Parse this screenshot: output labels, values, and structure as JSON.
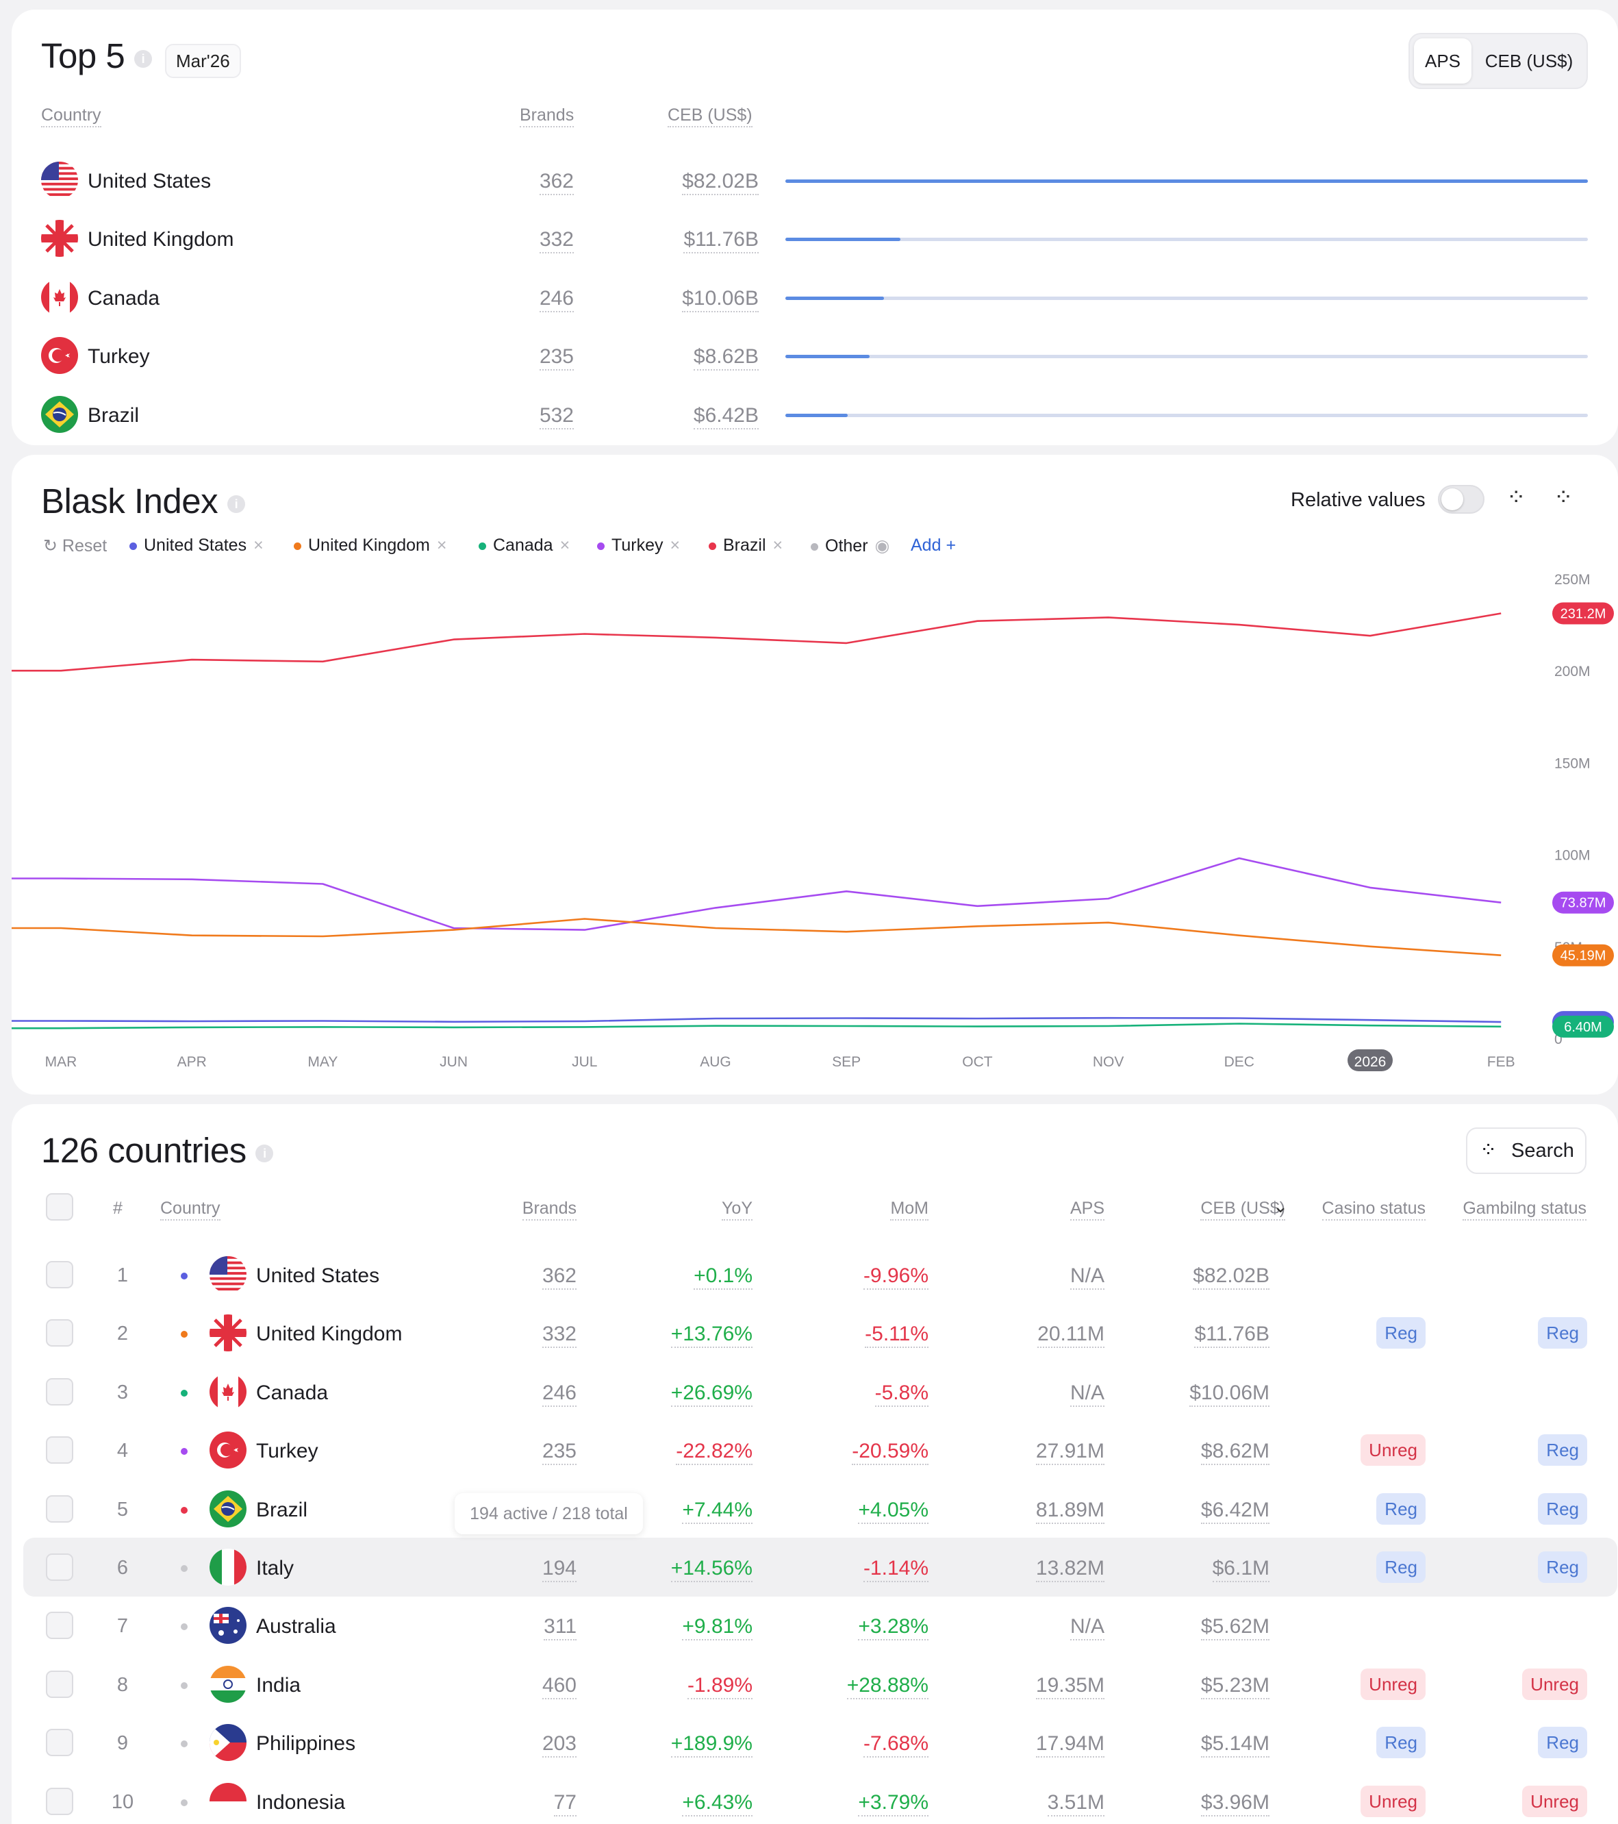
{
  "top5": {
    "title": "Top 5",
    "period": "Mar'26",
    "toggle": {
      "left": "APS",
      "right": "CEB (US$)"
    },
    "headers": {
      "country": "Country",
      "brands": "Brands",
      "ceb": "CEB (US$)"
    },
    "rows": [
      {
        "country": "United States",
        "brands": "362",
        "ceb": "$82.02B",
        "share": 1.0
      },
      {
        "country": "United Kingdom",
        "brands": "332",
        "ceb": "$11.76B",
        "share": 0.143
      },
      {
        "country": "Canada",
        "brands": "246",
        "ceb": "$10.06B",
        "share": 0.123
      },
      {
        "country": "Turkey",
        "brands": "235",
        "ceb": "$8.62B",
        "share": 0.105
      },
      {
        "country": "Brazil",
        "brands": "532",
        "ceb": "$6.42B",
        "share": 0.078
      }
    ]
  },
  "blask": {
    "title": "Blask Index",
    "relative_label": "Relative values",
    "reset_label": "Reset",
    "add_label": "Add",
    "legend": [
      {
        "name": "United States",
        "color": "#5b5fe0"
      },
      {
        "name": "United Kingdom",
        "color": "#f07a1c"
      },
      {
        "name": "Canada",
        "color": "#16b27a"
      },
      {
        "name": "Turkey",
        "color": "#a64bf0"
      },
      {
        "name": "Brazil",
        "color": "#e8354c"
      },
      {
        "name": "Other",
        "color": "#b8b8be"
      }
    ]
  },
  "chart_data": {
    "type": "line",
    "x": [
      "MAR",
      "APR",
      "MAY",
      "JUN",
      "JUL",
      "AUG",
      "SEP",
      "OCT",
      "NOV",
      "DEC",
      "2026",
      "FEB"
    ],
    "yticks": [
      "250M",
      "200M",
      "150M",
      "100M",
      "50M",
      "0"
    ],
    "ylim": [
      0,
      250
    ],
    "grid": false,
    "series": [
      {
        "name": "Brazil",
        "color": "#e8354c",
        "end_label": "231.2M",
        "values": [
          200,
          206,
          205,
          217,
          220,
          218,
          215,
          227,
          229,
          225,
          219,
          231.2
        ]
      },
      {
        "name": "Turkey",
        "color": "#a64bf0",
        "end_label": "73.87M",
        "values": [
          87,
          86.5,
          84,
          60,
          59,
          71,
          80,
          72,
          76,
          98,
          82,
          73.87
        ]
      },
      {
        "name": "United Kingdom",
        "color": "#f07a1c",
        "end_label": "45.19M",
        "values": [
          60,
          56,
          55.5,
          59,
          65,
          60,
          58,
          61,
          63,
          56,
          50,
          45.19
        ]
      },
      {
        "name": "United States",
        "color": "#5b5fe0",
        "end_label": "8.89M",
        "values": [
          9.5,
          9.3,
          9.5,
          9.0,
          9.3,
          10.8,
          11.0,
          10.8,
          11.1,
          11.0,
          10.0,
          8.89
        ]
      },
      {
        "name": "Canada",
        "color": "#16b27a",
        "end_label": "6.40M",
        "values": [
          5.5,
          6.0,
          6.2,
          6.0,
          6.2,
          6.8,
          6.7,
          6.5,
          6.7,
          8.0,
          7.0,
          6.4
        ]
      }
    ]
  },
  "countries": {
    "title": "126 countries",
    "search_label": "Search",
    "headers": {
      "num": "#",
      "country": "Country",
      "brands": "Brands",
      "yoy": "YoY",
      "mom": "MoM",
      "aps": "APS",
      "ceb": "CEB (US$)",
      "casino": "Casino status",
      "gambling": "Gambilng status"
    },
    "tooltip": "194 active / 218 total",
    "rows": [
      {
        "num": "1",
        "country": "United States",
        "dot": "#5b5fe0",
        "brands": "362",
        "yoy": "+0.1%",
        "mom": "-9.96%",
        "aps": "N/A",
        "ceb": "$82.02B",
        "casino": "",
        "gambling": ""
      },
      {
        "num": "2",
        "country": "United Kingdom",
        "dot": "#f07a1c",
        "brands": "332",
        "yoy": "+13.76%",
        "mom": "-5.11%",
        "aps": "20.11M",
        "ceb": "$11.76B",
        "casino": "Reg",
        "gambling": "Reg"
      },
      {
        "num": "3",
        "country": "Canada",
        "dot": "#16b27a",
        "brands": "246",
        "yoy": "+26.69%",
        "mom": "-5.8%",
        "aps": "N/A",
        "ceb": "$10.06M",
        "casino": "",
        "gambling": ""
      },
      {
        "num": "4",
        "country": "Turkey",
        "dot": "#a64bf0",
        "brands": "235",
        "yoy": "-22.82%",
        "mom": "-20.59%",
        "aps": "27.91M",
        "ceb": "$8.62M",
        "casino": "Unreg",
        "gambling": "Reg"
      },
      {
        "num": "5",
        "country": "Brazil",
        "dot": "#e8354c",
        "brands": "532",
        "yoy": "+7.44%",
        "mom": "+4.05%",
        "aps": "81.89M",
        "ceb": "$6.42M",
        "casino": "Reg",
        "gambling": "Reg"
      },
      {
        "num": "6",
        "country": "Italy",
        "dot": "#c8c8cc",
        "brands": "194",
        "yoy": "+14.56%",
        "mom": "-1.14%",
        "aps": "13.82M",
        "ceb": "$6.1M",
        "casino": "Reg",
        "gambling": "Reg"
      },
      {
        "num": "7",
        "country": "Australia",
        "dot": "#c8c8cc",
        "brands": "311",
        "yoy": "+9.81%",
        "mom": "+3.28%",
        "aps": "N/A",
        "ceb": "$5.62M",
        "casino": "",
        "gambling": ""
      },
      {
        "num": "8",
        "country": "India",
        "dot": "#c8c8cc",
        "brands": "460",
        "yoy": "-1.89%",
        "mom": "+28.88%",
        "aps": "19.35M",
        "ceb": "$5.23M",
        "casino": "Unreg",
        "gambling": "Unreg"
      },
      {
        "num": "9",
        "country": "Philippines",
        "dot": "#c8c8cc",
        "brands": "203",
        "yoy": "+189.9%",
        "mom": "-7.68%",
        "aps": "17.94M",
        "ceb": "$5.14M",
        "casino": "Reg",
        "gambling": "Reg"
      },
      {
        "num": "10",
        "country": "Indonesia",
        "dot": "#c8c8cc",
        "brands": "77",
        "yoy": "+6.43%",
        "mom": "+3.79%",
        "aps": "3.51M",
        "ceb": "$3.96M",
        "casino": "Unreg",
        "gambling": "Unreg"
      }
    ]
  }
}
